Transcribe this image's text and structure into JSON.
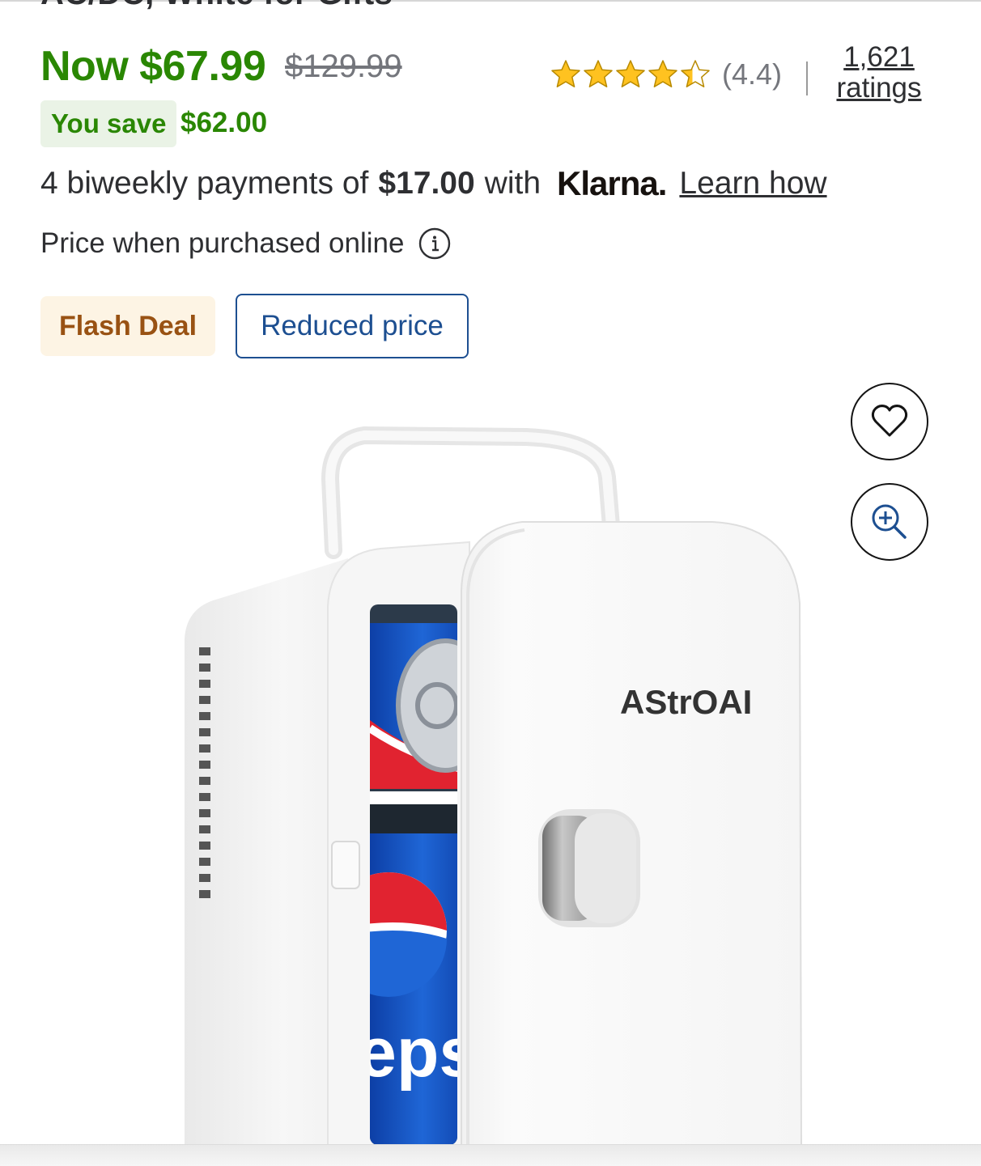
{
  "product": {
    "title_fragment": "AC/DC, White for Gifts"
  },
  "price": {
    "now_label": "Now $67.99",
    "was_label": "$129.99",
    "you_save_label": "You save",
    "you_save_amount": "$62.00"
  },
  "rating": {
    "stars": 4.4,
    "value_label": "(4.4)",
    "count_line1": "1,621",
    "count_line2": "ratings"
  },
  "klarna": {
    "prefix": "4 biweekly payments of",
    "amount": "$17.00",
    "with": "with",
    "logo": "Klarna.",
    "learn_how": "Learn how"
  },
  "price_note": {
    "text": "Price when purchased online",
    "icon": "info-icon"
  },
  "tags": {
    "flash_deal": "Flash Deal",
    "reduced_price": "Reduced price"
  },
  "actions": {
    "favorite_icon": "heart-icon",
    "zoom_icon": "zoom-in-icon"
  },
  "image": {
    "brand_on_fridge": "AStrOAI",
    "can_text": "eps"
  },
  "colors": {
    "price_green": "#2a8703",
    "save_bg": "#eaf3e6",
    "flash_bg": "#fdf4e4",
    "flash_text": "#995213",
    "reduced_blue": "#1d4f91",
    "star": "#ffc220"
  }
}
